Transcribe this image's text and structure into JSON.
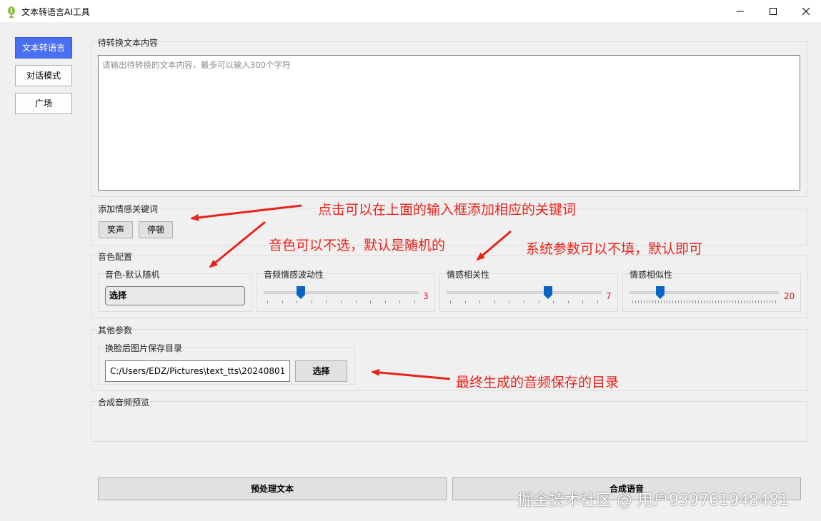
{
  "window": {
    "title": "文本转语言AI工具",
    "controls": {
      "minimize": "minimize-icon",
      "maximize": "maximize-icon",
      "close": "close-icon"
    }
  },
  "nav": {
    "items": [
      {
        "label": "文本转语言",
        "active": true
      },
      {
        "label": "对话模式",
        "active": false
      },
      {
        "label": "广场",
        "active": false
      }
    ],
    "active_color": "#4b6ff2"
  },
  "text_section": {
    "label": "待转换文本内容",
    "placeholder": "请输出待转换的文本内容，最多可以输入300个字符"
  },
  "emotion_keywords": {
    "label": "添加情感关键词",
    "buttons": [
      "笑声",
      "停顿"
    ]
  },
  "voice_config": {
    "label": "音色配置",
    "voice": {
      "label": "音色-默认随机",
      "button": "选择"
    },
    "sliders": [
      {
        "label": "音频情感波动性",
        "value": "3",
        "level": 0.25
      },
      {
        "label": "情感相关性",
        "value": "7",
        "level": 0.65
      },
      {
        "label": "情感相似性",
        "value": "20",
        "level": 0.2
      }
    ]
  },
  "other_params": {
    "label": "其他参数",
    "save_dir": {
      "label": "换脸后图片保存目录",
      "value": "C:/Users/EDZ/Pictures\\text_tts\\20240801",
      "button": "选择"
    }
  },
  "preview": {
    "label": "合成音频预览"
  },
  "actions": {
    "preprocess": "预处理文本",
    "synthesize": "合成语音"
  },
  "annotations": {
    "keywords": "点击可以在上面的输入框添加相应的关键词",
    "voice": "音色可以不选，默认是随机的",
    "params": "系统参数可以不填，默认即可",
    "dir": "最终生成的音频保存的目录",
    "color": "#e8231c"
  },
  "watermark": "掘金技术社区 @ 用户939761948481"
}
